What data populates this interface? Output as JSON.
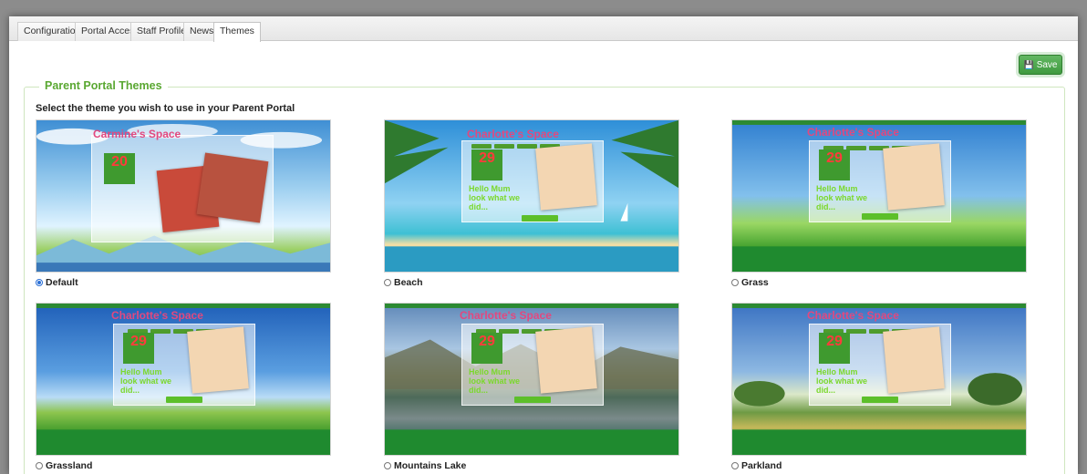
{
  "tabs": [
    {
      "label": "Configuration"
    },
    {
      "label": "Portal Access"
    },
    {
      "label": "Staff Profiles"
    },
    {
      "label": "News"
    },
    {
      "label": "Themes",
      "active": true
    }
  ],
  "toolbar": {
    "save_label": "Save",
    "save_icon": "save-icon"
  },
  "section": {
    "legend": "Parent Portal Themes",
    "instruction": "Select the theme you wish to use in your Parent Portal"
  },
  "themes": [
    {
      "name": "Default",
      "selected": true,
      "site_title": "Carmine's Space",
      "date_day": "20",
      "background": "sky-clouds-mountains"
    },
    {
      "name": "Beach",
      "selected": false,
      "site_title": "Charlotte's Space",
      "date_day": "29",
      "background": "beach-palms"
    },
    {
      "name": "Grass",
      "selected": false,
      "site_title": "Charlotte's Space",
      "date_day": "29",
      "background": "grass"
    },
    {
      "name": "Grassland",
      "selected": false,
      "site_title": "Charlotte's Space",
      "date_day": "29",
      "background": "grassland"
    },
    {
      "name": "Mountains Lake",
      "selected": false,
      "site_title": "Charlotte's Space",
      "date_day": "29",
      "background": "mountains-lake"
    },
    {
      "name": "Parkland",
      "selected": false,
      "site_title": "Charlotte's Space",
      "date_day": "29",
      "background": "parkland"
    }
  ],
  "preview_text": {
    "hello": "Hello Mum look what we did..."
  },
  "colors": {
    "accent_green": "#5aa832",
    "save_button": "#4cab4c",
    "site_title_pink": "#e2487f",
    "radio_selected": "#2a6fd6"
  }
}
